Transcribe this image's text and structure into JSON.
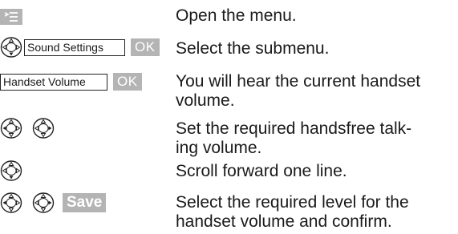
{
  "steps": [
    {
      "description": "Open the menu."
    },
    {
      "display_text": "Sound Settings",
      "ok_label": "OK",
      "description": "Select the submenu."
    },
    {
      "display_text": "Handset Volume",
      "ok_label": "OK",
      "description_line1": "You will hear the current handset",
      "description_line2": "volume."
    },
    {
      "description_line1": "Set the required handsfree talk-",
      "description_line2": "ing volume."
    },
    {
      "description": "Scroll forward one line."
    },
    {
      "save_label": "Save",
      "description_line1": "Select the required level for the",
      "description_line2": "handset volume and confirm."
    }
  ],
  "icons": {
    "menu_key": "menu-icon",
    "control_key": "control-key-icon"
  },
  "colors": {
    "key_background": "#b4b4b4",
    "key_text": "#ffffff",
    "text": "#1a1a1a"
  }
}
